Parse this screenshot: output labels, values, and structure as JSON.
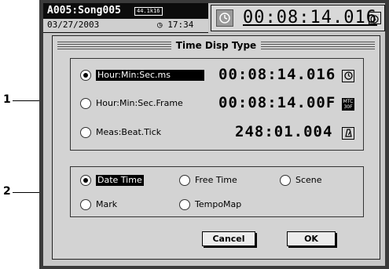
{
  "status": {
    "song": "A005:Song005",
    "sample_rate": "44.1k16",
    "date": "03/27/2003",
    "clock": "◷ 17:34",
    "time_display": "00:08:14.016"
  },
  "dialog": {
    "title": "Time Disp Type",
    "time_options": [
      {
        "label": "Hour:Min:Sec.ms",
        "value": "00:08:14.016",
        "selected": true,
        "icon": "clock-icon"
      },
      {
        "label": "Hour:Min:Sec.Frame",
        "value": "00:08:14.00F",
        "selected": false,
        "icon": "mtc-icon",
        "icon_text": "MTC 30F"
      },
      {
        "label": "Meas:Beat.Tick",
        "value": "248:01.004",
        "selected": false,
        "icon": "metronome-icon"
      }
    ],
    "display_options": [
      {
        "label": "Date Time",
        "selected": true
      },
      {
        "label": "Free Time",
        "selected": false
      },
      {
        "label": "Scene",
        "selected": false
      },
      {
        "label": "Mark",
        "selected": false
      },
      {
        "label": "TempoMap",
        "selected": false
      }
    ],
    "cancel_label": "Cancel",
    "ok_label": "OK"
  },
  "callouts": [
    "1",
    "2"
  ]
}
